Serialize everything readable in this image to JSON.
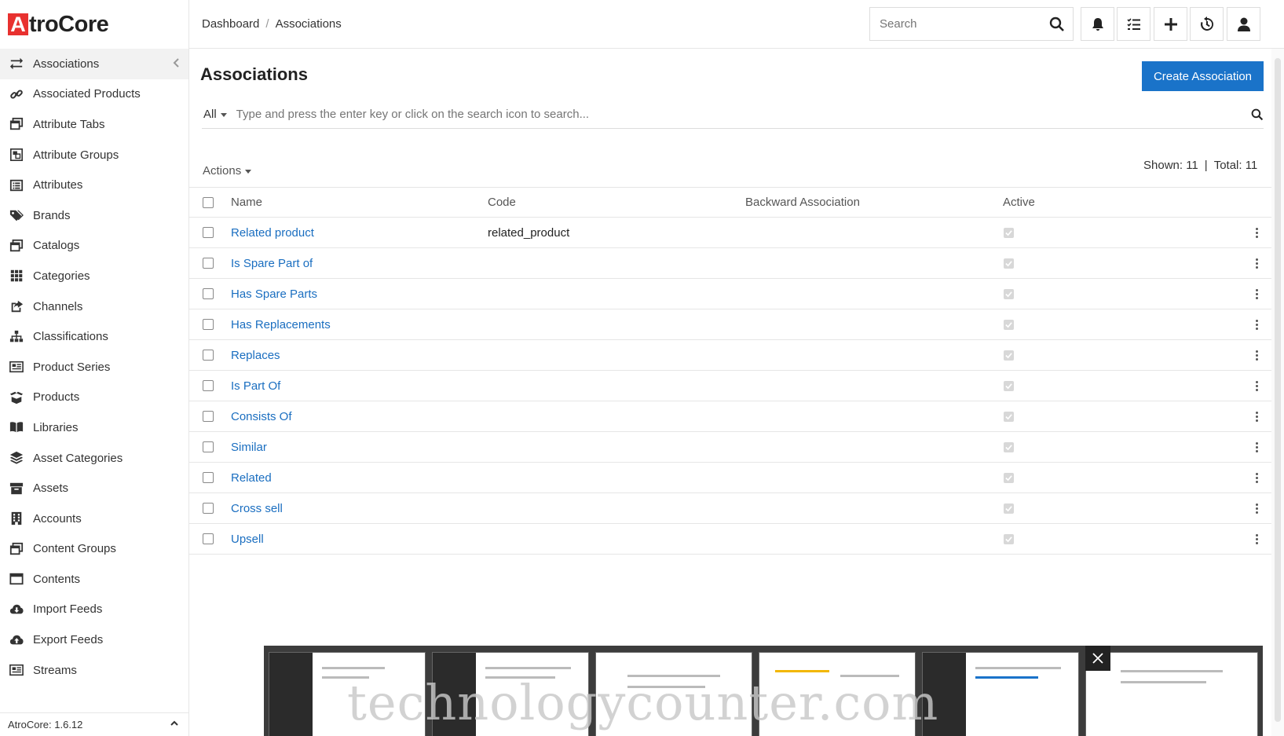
{
  "brand": {
    "logo_letter": "A",
    "logo_text": "troCore"
  },
  "sidebar": {
    "items": [
      {
        "label": "Associations",
        "icon": "arrows-exchange-icon",
        "active": true
      },
      {
        "label": "Associated Products",
        "icon": "link-icon"
      },
      {
        "label": "Attribute Tabs",
        "icon": "window-restore-icon"
      },
      {
        "label": "Attribute Groups",
        "icon": "object-group-icon"
      },
      {
        "label": "Attributes",
        "icon": "list-alt-icon"
      },
      {
        "label": "Brands",
        "icon": "tags-icon"
      },
      {
        "label": "Catalogs",
        "icon": "window-restore-icon"
      },
      {
        "label": "Categories",
        "icon": "th-grid-icon"
      },
      {
        "label": "Channels",
        "icon": "share-square-icon"
      },
      {
        "label": "Classifications",
        "icon": "sitemap-icon"
      },
      {
        "label": "Product Series",
        "icon": "newspaper-icon"
      },
      {
        "label": "Products",
        "icon": "box-open-icon"
      },
      {
        "label": "Libraries",
        "icon": "book-open-icon"
      },
      {
        "label": "Asset Categories",
        "icon": "layer-group-icon"
      },
      {
        "label": "Assets",
        "icon": "archive-icon"
      },
      {
        "label": "Accounts",
        "icon": "building-icon"
      },
      {
        "label": "Content Groups",
        "icon": "window-restore-icon"
      },
      {
        "label": "Contents",
        "icon": "window-maximize-icon"
      },
      {
        "label": "Import Feeds",
        "icon": "cloud-download-icon"
      },
      {
        "label": "Export Feeds",
        "icon": "cloud-upload-icon"
      },
      {
        "label": "Streams",
        "icon": "newspaper-icon"
      }
    ],
    "footer_version": "AtroCore: 1.6.12"
  },
  "header": {
    "breadcrumb": [
      "Dashboard",
      "Associations"
    ],
    "breadcrumb_sep": "/",
    "search_placeholder": "Search"
  },
  "main": {
    "title": "Associations",
    "create_button": "Create Association",
    "filter": {
      "scope": "All",
      "placeholder": "Type and press the enter key or click on the search icon to search..."
    },
    "actions_label": "Actions",
    "shown_label": "Shown: 11",
    "total_label": "Total: 11",
    "columns": [
      "Name",
      "Code",
      "Backward Association",
      "Active"
    ],
    "rows": [
      {
        "name": "Related product",
        "code": "related_product",
        "backward": ""
      },
      {
        "name": "Is Spare Part of",
        "code": "",
        "backward": ""
      },
      {
        "name": "Has Spare Parts",
        "code": "",
        "backward": ""
      },
      {
        "name": "Has Replacements",
        "code": "",
        "backward": ""
      },
      {
        "name": "Replaces",
        "code": "",
        "backward": ""
      },
      {
        "name": "Is Part Of",
        "code": "",
        "backward": ""
      },
      {
        "name": "Consists Of",
        "code": "",
        "backward": ""
      },
      {
        "name": "Similar",
        "code": "",
        "backward": ""
      },
      {
        "name": "Related",
        "code": "",
        "backward": ""
      },
      {
        "name": "Cross sell",
        "code": "",
        "backward": ""
      },
      {
        "name": "Upsell",
        "code": "",
        "backward": ""
      }
    ]
  },
  "overlay": {
    "watermark": "technologycounter.com"
  },
  "colors": {
    "brand_red": "#e8312f",
    "link_blue": "#1a6ec0",
    "primary_button": "#1a73c9"
  }
}
